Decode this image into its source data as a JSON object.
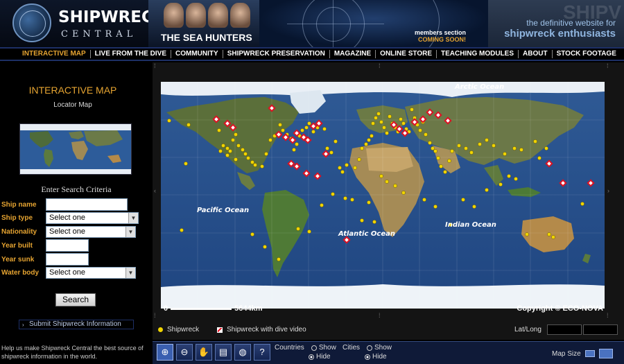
{
  "header": {
    "logo_title": "SHIPWRECK",
    "logo_subtitle": "CENTRAL",
    "sea_hunters": "THE SEA HUNTERS",
    "members_line1": "members section",
    "members_line2": "COMING SOON!",
    "tag_big": "SHIPV",
    "tagline1": "the definitive website for",
    "tagline2": "shipwreck enthusiasts"
  },
  "nav": {
    "items": [
      "INTERACTIVE MAP",
      "LIVE FROM THE DIVE",
      "COMMUNITY",
      "SHIPWRECK PRESERVATION",
      "MAGAZINE",
      "ONLINE STORE",
      "TEACHING MODULES",
      "ABOUT",
      "STOCK FOOTAGE"
    ],
    "active": "INTERACTIVE MAP"
  },
  "sidebar": {
    "title": "INTERACTIVE MAP",
    "locator_label": "Locator Map",
    "search_heading": "Enter Search Criteria",
    "fields": {
      "ship_name": "Ship name",
      "ship_type": "Ship type",
      "ship_type_value": "Select one",
      "nationality": "Nationality",
      "nationality_value": "Select one",
      "year_built": "Year built",
      "year_sunk": "Year sunk",
      "water_body": "Water body",
      "water_body_value": "Select one"
    },
    "search_button": "Search",
    "submit_link": "Submit Shipwreck Information",
    "help_text": "Help us make Shipwreck Central the best source of shipwreck information in the world."
  },
  "map": {
    "labels": {
      "arctic": "Arctic Ocean",
      "pacific": "Pacific Ocean",
      "atlantic": "Atlantic Ocean",
      "indian": "Indian Ocean"
    },
    "scale_start": "0",
    "scale_end": "5644km",
    "copyright": "Copyright © ECO-NOVA",
    "legend_shipwreck": "Shipwreck",
    "legend_dive": "Shipwreck with dive video",
    "latlong_label": "Lat/Long"
  },
  "toolbar": {
    "tools": [
      {
        "name": "zoom-in-icon",
        "glyph": "⊕"
      },
      {
        "name": "zoom-out-icon",
        "glyph": "⊖"
      },
      {
        "name": "pan-hand-icon",
        "glyph": "✋"
      },
      {
        "name": "measure-ruler-icon",
        "glyph": "▤"
      },
      {
        "name": "globe-icon",
        "glyph": "◍"
      },
      {
        "name": "help-icon",
        "glyph": "?"
      }
    ],
    "countries_label": "Countries",
    "cities_label": "Cities",
    "show": "Show",
    "hide": "Hide",
    "map_size": "Map Size"
  },
  "colors": {
    "accent": "#e6a431",
    "shipwreck_dot": "#f0d400",
    "dive_marker": "#dd1122",
    "nav_border": "#1d2f66"
  }
}
